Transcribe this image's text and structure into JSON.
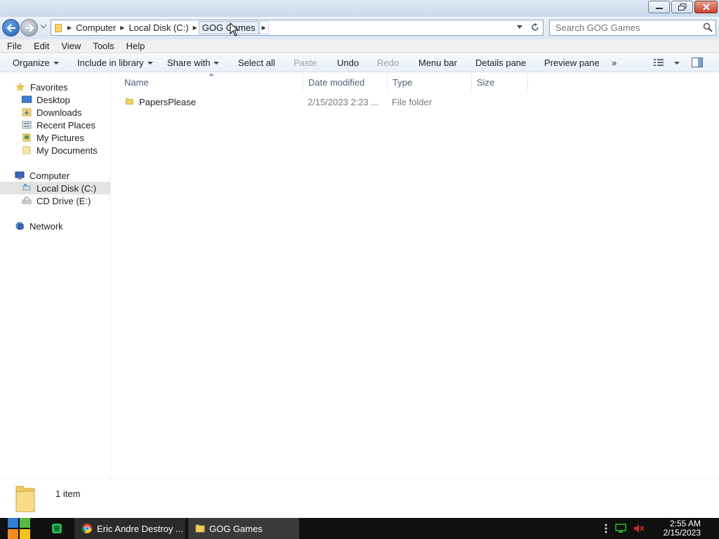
{
  "window": {
    "controls": {
      "minimize": "minimize-icon",
      "restore": "restore-icon",
      "close": "close-icon"
    }
  },
  "address": {
    "crumbs": [
      "Computer",
      "Local Disk (C:)",
      "GOG Games"
    ],
    "search_placeholder": "Search GOG Games"
  },
  "menubar": [
    "File",
    "Edit",
    "View",
    "Tools",
    "Help"
  ],
  "commands": {
    "organize": "Organize",
    "include_in_library": "Include in library",
    "share_with": "Share with",
    "select_all": "Select all",
    "paste": "Paste",
    "undo": "Undo",
    "redo": "Redo",
    "menu_bar": "Menu bar",
    "details_pane": "Details pane",
    "preview_pane": "Preview pane",
    "more": "»"
  },
  "nav": {
    "favorites": "Favorites",
    "desktop": "Desktop",
    "downloads": "Downloads",
    "recent_places": "Recent Places",
    "my_pictures": "My Pictures",
    "my_documents": "My Documents",
    "computer": "Computer",
    "local_disk": "Local Disk (C:)",
    "cd_drive": "CD Drive (E:)",
    "network": "Network"
  },
  "columns": {
    "name": "Name",
    "date_modified": "Date modified",
    "type": "Type",
    "size": "Size"
  },
  "files": [
    {
      "name": "PapersPlease",
      "date_modified": "2/15/2023 2:23 ...",
      "type": "File folder",
      "size": ""
    }
  ],
  "details": {
    "item_count": "1 item"
  },
  "taskbar": {
    "task1": "Eric Andre Destroy ...",
    "task2": "GOG Games",
    "time": "2:55 AM",
    "date": "2/15/2023"
  },
  "colors": {
    "accent": "#1f5fae",
    "selection": "#e3e3e3",
    "taskbar": "#101010"
  }
}
